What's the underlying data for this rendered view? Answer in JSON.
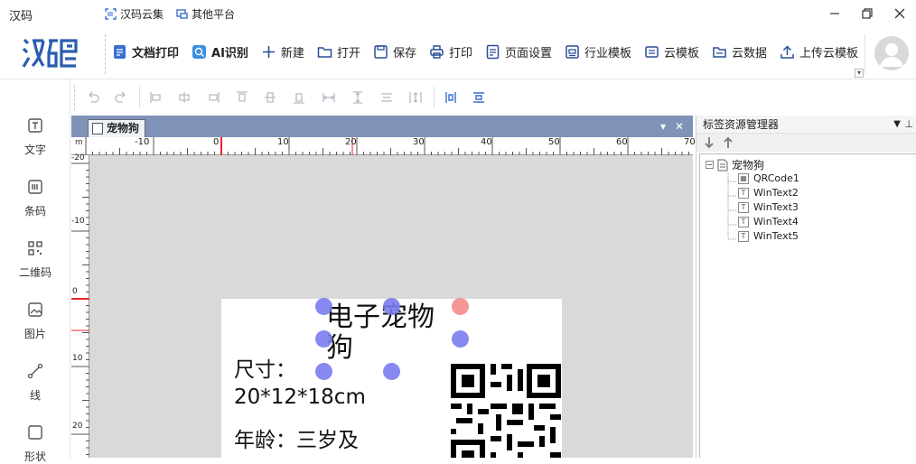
{
  "app": {
    "title": "汉码"
  },
  "titlebar": {
    "links": [
      {
        "label": "汉码云集"
      },
      {
        "label": "其他平台"
      }
    ]
  },
  "toolbar": {
    "logo_text": "汉码",
    "items": [
      {
        "label": "文档打印",
        "icon": "document-print-icon",
        "bold": true
      },
      {
        "label": "AI识别",
        "icon": "ai-recognize-icon",
        "bold": true
      },
      {
        "label": "新建",
        "icon": "plus-icon"
      },
      {
        "label": "打开",
        "icon": "folder-icon"
      },
      {
        "label": "保存",
        "icon": "save-icon"
      },
      {
        "label": "打印",
        "icon": "printer-icon"
      },
      {
        "label": "页面设置",
        "icon": "page-setup-icon"
      },
      {
        "label": "行业模板",
        "icon": "template-icon"
      },
      {
        "label": "云模板",
        "icon": "cloud-template-icon"
      },
      {
        "label": "云数据",
        "icon": "cloud-data-icon"
      },
      {
        "label": "上传云模板",
        "icon": "upload-icon"
      }
    ]
  },
  "sidebar": {
    "items": [
      {
        "label": "文字",
        "icon": "text-icon"
      },
      {
        "label": "条码",
        "icon": "barcode-icon"
      },
      {
        "label": "二维码",
        "icon": "qrcode-icon"
      },
      {
        "label": "图片",
        "icon": "image-icon"
      },
      {
        "label": "线",
        "icon": "line-icon"
      },
      {
        "label": "形状",
        "icon": "shape-icon"
      }
    ]
  },
  "document": {
    "tab_label": "宠物狗",
    "ruler_unit": "m",
    "ruler_h_ticks": [
      "-10",
      "0",
      "10",
      "20",
      "30",
      "40",
      "50",
      "60",
      "70"
    ],
    "ruler_v_ticks": [
      "-20",
      "-10",
      "0",
      "10",
      "20"
    ],
    "label": {
      "title": "电子宠物狗",
      "line1": "尺寸：20*12*18cm",
      "line2": "年龄：三岁及"
    }
  },
  "resource_panel": {
    "title": "标签资源管理器",
    "root": "宠物狗",
    "nodes": [
      "QRCode1",
      "WinText2",
      "WinText3",
      "WinText4",
      "WinText5"
    ]
  },
  "colors": {
    "accent": "#3a6fd1",
    "tabbar": "#7f92b8",
    "handle": "#7b7bf0",
    "handle_red": "#f48b8b"
  }
}
